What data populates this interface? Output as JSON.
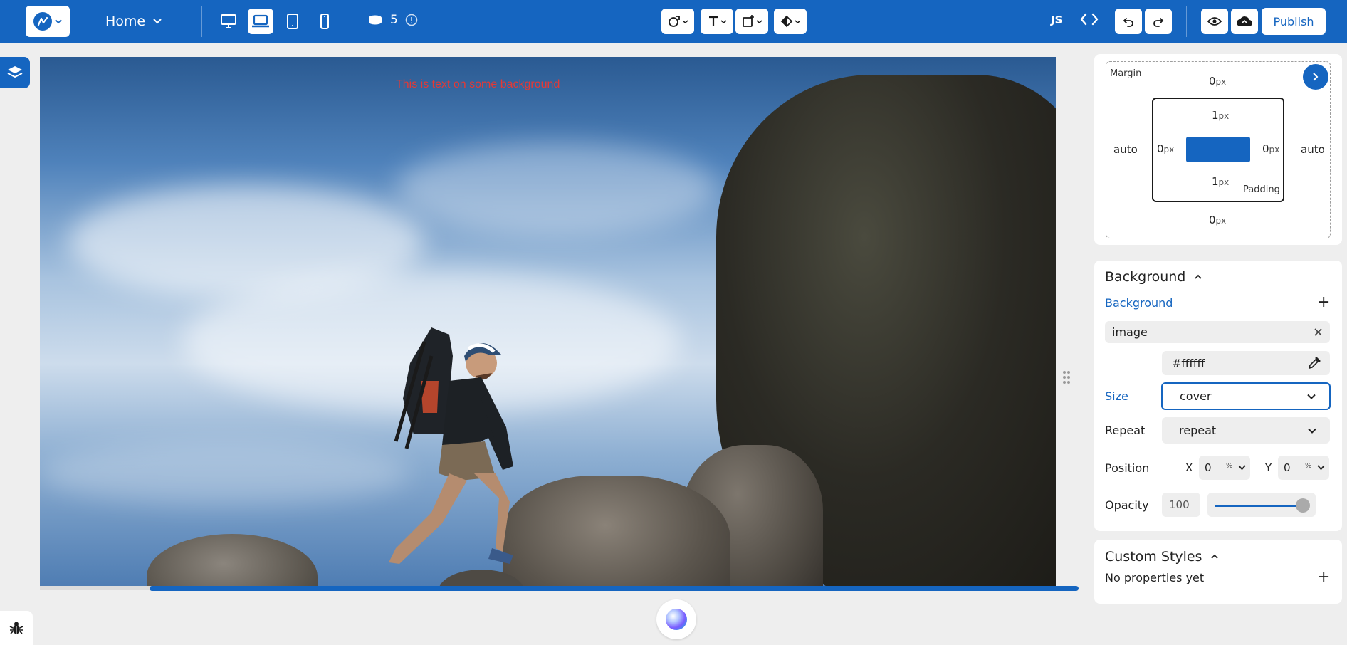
{
  "topbar": {
    "page_name": "Home",
    "db_count": "5",
    "js_label": "JS",
    "publish_label": "Publish"
  },
  "canvas": {
    "text": "This is text on some background"
  },
  "spacing": {
    "margin_label": "Margin",
    "padding_label": "Padding",
    "margin_top": "0",
    "margin_bottom": "0",
    "margin_left": "auto",
    "margin_right": "auto",
    "padding_top": "1",
    "padding_bottom": "1",
    "padding_left": "0",
    "padding_right": "0",
    "unit": "px"
  },
  "background": {
    "section_title": "Background",
    "sub_label": "Background",
    "layer_type": "image",
    "color": "#ffffff",
    "size_label": "Size",
    "size_value": "cover",
    "repeat_label": "Repeat",
    "repeat_value": "repeat",
    "position_label": "Position",
    "x_label": "X",
    "x_value": "0",
    "x_unit": "%",
    "y_label": "Y",
    "y_value": "0",
    "y_unit": "%",
    "opacity_label": "Opacity",
    "opacity_value": "100",
    "opacity_level": 100
  },
  "custom_styles": {
    "title": "Custom Styles",
    "empty_text": "No properties yet"
  },
  "colors": {
    "accent": "#1565c0",
    "canvas_text": "#e53935"
  }
}
